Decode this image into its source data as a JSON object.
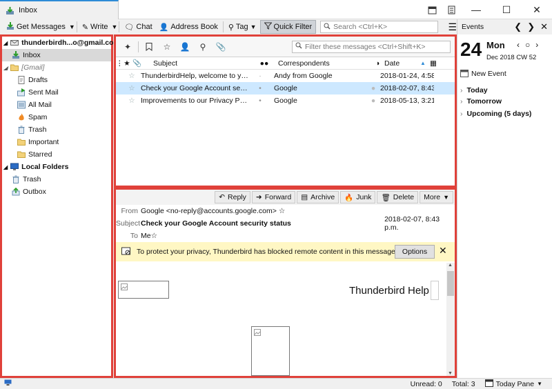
{
  "window": {
    "tab_title": "Inbox"
  },
  "toolbar": {
    "get_messages": "Get Messages",
    "write": "Write",
    "chat": "Chat",
    "address_book": "Address Book",
    "tag": "Tag",
    "quick_filter": "Quick Filter",
    "search_placeholder": "Search <Ctrl+K>"
  },
  "folders": {
    "account": "thunderbirdh...o@gmail.com",
    "inbox": "Inbox",
    "gmail": "[Gmail]",
    "gmail_children": [
      "Drafts",
      "Sent Mail",
      "All Mail",
      "Spam",
      "Trash",
      "Important",
      "Starred"
    ],
    "local": "Local Folders",
    "local_children": [
      "Trash",
      "Outbox"
    ]
  },
  "quickfilter": {
    "placeholder": "Filter these messages <Ctrl+Shift+K>"
  },
  "columns": {
    "subject": "Subject",
    "correspondents": "Correspondents",
    "date": "Date"
  },
  "messages": [
    {
      "subject": "ThunderbirdHelp, welcome to your...",
      "from": "Andy from Google",
      "date": "2018-01-24, 4:58 ..."
    },
    {
      "subject": "Check your Google Account securi...",
      "from": "Google",
      "date": "2018-02-07, 8:43 ..."
    },
    {
      "subject": "Improvements to our Privacy Polic...",
      "from": "Google",
      "date": "2018-05-13, 3:21 ..."
    }
  ],
  "message_view": {
    "actions": {
      "reply": "Reply",
      "forward": "Forward",
      "archive": "Archive",
      "junk": "Junk",
      "delete": "Delete",
      "more": "More"
    },
    "from_label": "From",
    "from": "Google <no-reply@accounts.google.com>",
    "subject_label": "Subject",
    "subject": "Check your Google Account security status",
    "date": "2018-02-07, 8:43 p.m.",
    "to_label": "To",
    "to": "Me",
    "notice": "To protect your privacy, Thunderbird has blocked remote content in this message.",
    "options": "Options",
    "body_heading": "Thunderbird Help"
  },
  "today_pane": {
    "events": "Events",
    "day": "24",
    "weekday": "Mon",
    "month_week": "Dec 2018   CW 52",
    "new_event": "New Event",
    "groups": [
      "Today",
      "Tomorrow",
      "Upcoming (5 days)"
    ]
  },
  "status": {
    "unread": "Unread: 0",
    "total": "Total: 3",
    "today_pane": "Today Pane"
  }
}
